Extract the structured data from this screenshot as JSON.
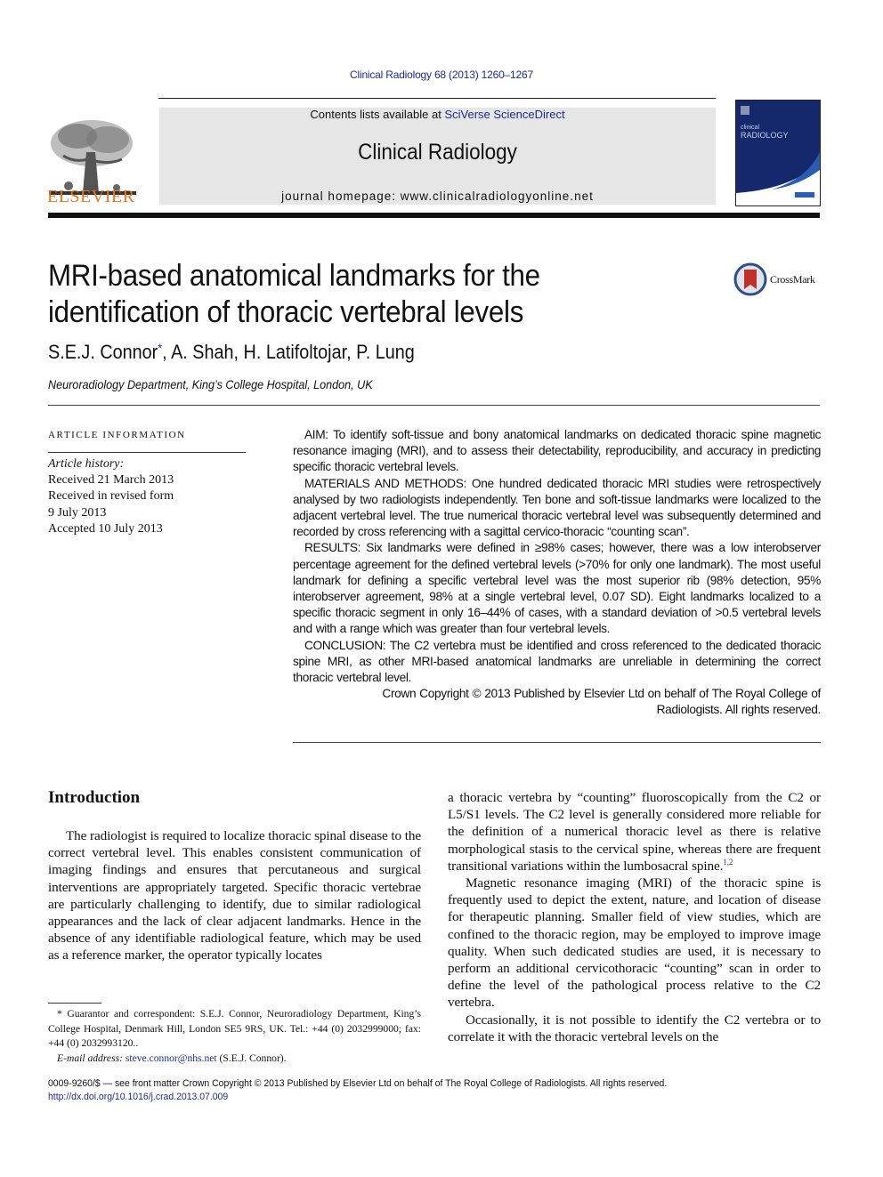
{
  "header": {
    "citation": "Clinical Radiology 68 (2013) 1260–1267",
    "contents_prefix": "Contents lists available at ",
    "contents_link": "SciVerse ScienceDirect",
    "journal_name": "Clinical Radiology",
    "homepage": "journal homepage: www.clinicalradiologyonline.net",
    "publisher_logo_text": "ELSEVIER",
    "cover_title_small": "clinical",
    "cover_title_large": "RADIOLOGY",
    "crossmark_label": "CrossMark"
  },
  "colors": {
    "link": "#1d2c8f",
    "elsevier_orange": "#e87722",
    "masthead_gray": "#e6e6e6",
    "cover_navy": "#14286b",
    "cover_blue": "#2a5db0",
    "crossmark_red": "#c0302a"
  },
  "article": {
    "title_line1": "MRI-based anatomical landmarks for the",
    "title_line2": "identification of thoracic vertebral levels",
    "authors_before": "S.E.J. Connor",
    "author_mark": "*",
    "authors_after": ", A. Shah, H. Latifoltojar, P. Lung",
    "affiliation": "Neuroradiology Department, King’s College Hospital, London, UK"
  },
  "article_info": {
    "heading": "ARTICLE INFORMATION",
    "history_label": "Article history:",
    "history": [
      "Received 21 March 2013",
      "Received in revised form",
      "9 July 2013",
      "Accepted 10 July 2013"
    ]
  },
  "abstract": {
    "aim": "AIM: To identify soft-tissue and bony anatomical landmarks on dedicated thoracic spine magnetic resonance imaging (MRI), and to assess their detectability, reproducibility, and accuracy in predicting specific thoracic vertebral levels.",
    "methods": "MATERIALS AND METHODS: One hundred dedicated thoracic MRI studies were retrospectively analysed by two radiologists independently. Ten bone and soft-tissue landmarks were localized to the adjacent vertebral level. The true numerical thoracic vertebral level was subsequently determined and recorded by cross referencing with a sagittal cervico-thoracic “counting scan”.",
    "results": "RESULTS: Six landmarks were defined in ≥98% cases; however, there was a low interobserver percentage agreement for the defined vertebral levels (>70% for only one landmark). The most useful landmark for defining a specific vertebral level was the most superior rib (98% detection, 95% interobserver agreement, 98% at a single vertebral level, 0.07 SD). Eight landmarks localized to a specific thoracic segment in only 16–44% of cases, with a standard deviation of >0.5 vertebral levels and with a range which was greater than four vertebral levels.",
    "conclusion": "CONCLUSION: The C2 vertebra must be identified and cross referenced to the dedicated thoracic spine MRI, as other MRI-based anatomical landmarks are unreliable in determining the correct thoracic vertebral level.",
    "copyright_line1": "Crown Copyright © 2013 Published by Elsevier Ltd on behalf of The Royal College of",
    "copyright_line2": "Radiologists. All rights reserved."
  },
  "body": {
    "intro_heading": "Introduction",
    "left_para": "The radiologist is required to localize thoracic spinal disease to the correct vertebral level. This enables consistent communication of imaging findings and ensures that percutaneous and surgical interventions are appropriately targeted. Specific thoracic vertebrae are particularly challenging to identify, due to similar radiological appearances and the lack of clear adjacent landmarks. Hence in the absence of any identifiable radiological feature, which may be used as a reference marker, the operator typically locates",
    "right_para1": "a thoracic vertebra by “counting” fluoroscopically from the C2 or L5/S1 levels. The C2 level is generally considered more reliable for the definition of a numerical thoracic level as there is relative morphological stasis to the cervical spine, whereas there are frequent transitional variations within the lumbosacral spine.",
    "right_para1_ref": "1,2",
    "right_para2": "Magnetic resonance imaging (MRI) of the thoracic spine is frequently used to depict the extent, nature, and location of disease for therapeutic planning. Smaller field of view studies, which are confined to the thoracic region, may be employed to improve image quality. When such dedicated studies are used, it is necessary to perform an additional cervicothoracic “counting” scan in order to define the level of the pathological process relative to the C2 vertebra.",
    "right_para3": "Occasionally, it is not possible to identify the C2 vertebra or to correlate it with the thoracic vertebral levels on the"
  },
  "footnote": {
    "text": "* Guarantor and correspondent: S.E.J. Connor, Neuroradiology Department, King’s College Hospital, Denmark Hill, London SE5 9RS, UK. Tel.: +44 (0) 2032999000; fax: +44 (0) 2032993120..",
    "email_label": "E-mail address: ",
    "email": "steve.connor@nhs.net",
    "email_suffix": " (S.E.J. Connor)."
  },
  "footer": {
    "issn_line": "0009-9260/$ — see front matter Crown Copyright © 2013 Published by Elsevier Ltd on behalf of The Royal College of Radiologists. All rights reserved.",
    "doi": "http://dx.doi.org/10.1016/j.crad.2013.07.009"
  }
}
